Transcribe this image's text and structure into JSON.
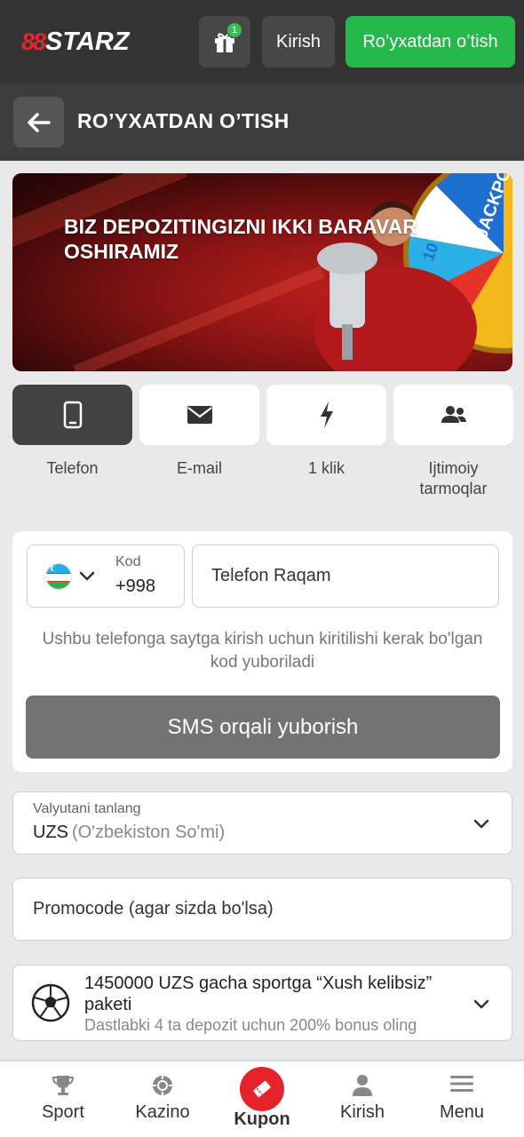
{
  "header": {
    "logo_mark": "88",
    "logo_word": "STARZ",
    "gift_badge": "1",
    "login_label": "Kirish",
    "register_label": "Ro’yxatdan o’tish"
  },
  "page": {
    "title": "RO’YXATDAN O’TISH"
  },
  "banner": {
    "text": "BIZ DEPOZITINGIZNI IKKI BARAVAR OSHIRAMIZ",
    "wheel_labels": [
      "JACKPOT",
      "10"
    ]
  },
  "methods": [
    {
      "label": "Telefon",
      "icon": "phone-icon",
      "active": true
    },
    {
      "label": "E-mail",
      "icon": "envelope-icon",
      "active": false
    },
    {
      "label": "1 klik",
      "icon": "lightning-icon",
      "active": false
    },
    {
      "label": "Ijtimoiy tarmoqlar",
      "icon": "users-icon",
      "active": false
    }
  ],
  "phone_form": {
    "kod_label": "Kod",
    "kod_value": "+998",
    "phone_placeholder": "Telefon Raqam",
    "hint": "Ushbu telefonga saytga kirish uchun kiritilishi kerak bo'lgan kod yuboriladi",
    "sms_button": "SMS orqali yuborish"
  },
  "currency": {
    "label": "Valyutani tanlang",
    "code": "UZS",
    "name": "(O'zbekiston So'mi)"
  },
  "promo": {
    "placeholder": "Promocode (agar sizda bo'lsa)"
  },
  "bonus": {
    "title": "1450000 UZS gacha sportga “Xush kelibsiz” paketi",
    "subtitle": "Dastlabki 4 ta depozit uchun 200% bonus oling"
  },
  "bottom_nav": [
    {
      "label": "Sport",
      "icon": "trophy-icon"
    },
    {
      "label": "Kazino",
      "icon": "chip-icon"
    },
    {
      "label": "Kupon",
      "icon": "ticket-icon"
    },
    {
      "label": "Kirish",
      "icon": "person-icon"
    },
    {
      "label": "Menu",
      "icon": "menu-icon"
    }
  ],
  "colors": {
    "topbar": "#333333",
    "accent_green": "#25b84a",
    "accent_red": "#e5232a",
    "active_tab": "#424242"
  }
}
